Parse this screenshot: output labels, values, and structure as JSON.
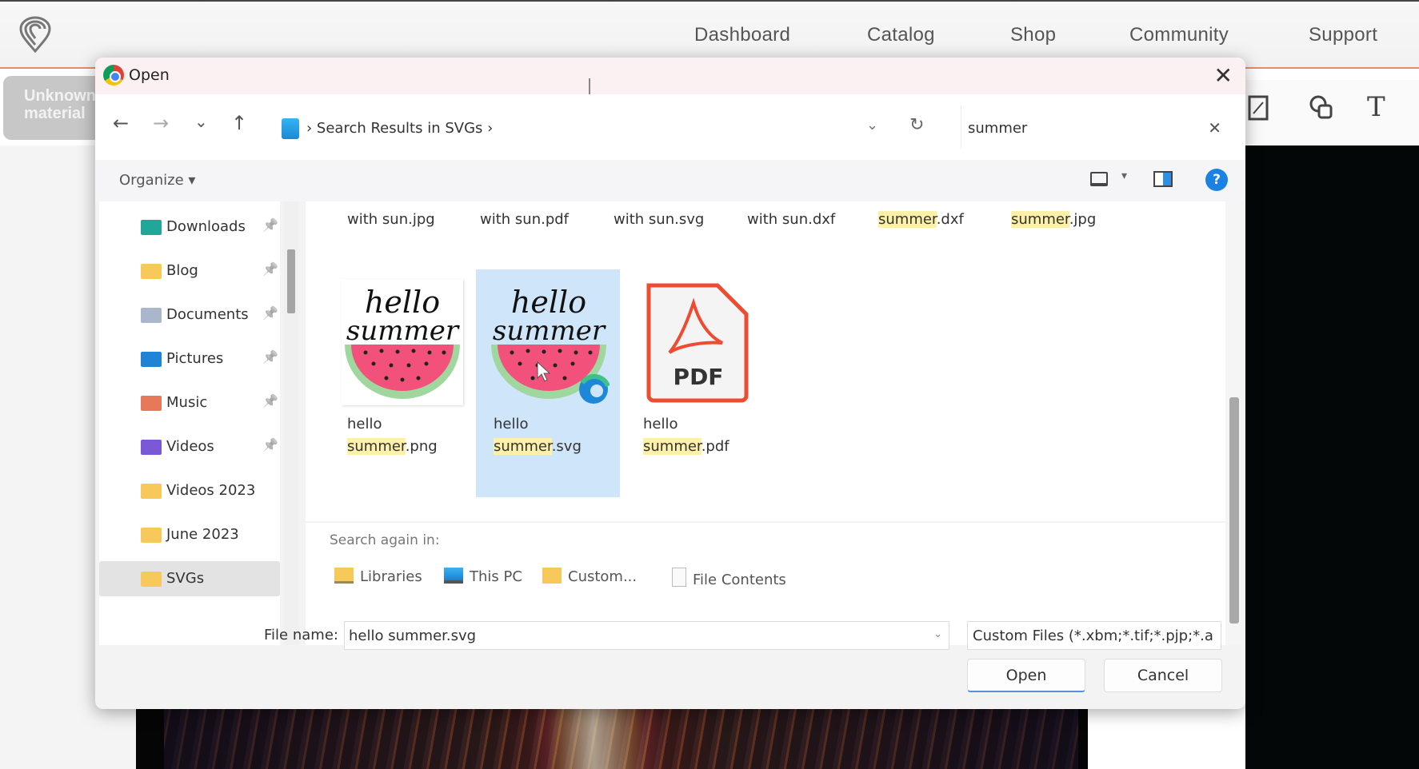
{
  "app": {
    "nav": [
      "Dashboard",
      "Catalog",
      "Shop",
      "Community",
      "Support"
    ],
    "left_button": "Unknown material",
    "tools": [
      "trace-image-icon",
      "shapes-icon",
      "text-icon"
    ],
    "text_tool_glyph": "T"
  },
  "dialog": {
    "title": "Open",
    "close_glyph": "✕",
    "nav_buttons": {
      "back": "←",
      "forward": "→",
      "recent": "⌄",
      "up": "↑"
    },
    "breadcrumb": "Search Results in SVGs",
    "refresh_glyph": "↻",
    "address_dropdown_glyph": "⌄",
    "search": {
      "value": "summer",
      "clear_glyph": "✕"
    },
    "toolbar": {
      "organize": "Organize ▾",
      "help": "?",
      "view_dot": "▾"
    },
    "navpane": [
      {
        "label": "Downloads",
        "pinned": true,
        "color": "#1fa89a"
      },
      {
        "label": "Blog",
        "pinned": true,
        "color": "#f6c95a"
      },
      {
        "label": "Documents",
        "pinned": true,
        "color": "#a9b6cc"
      },
      {
        "label": "Pictures",
        "pinned": true,
        "color": "#1f84d6"
      },
      {
        "label": "Music",
        "pinned": true,
        "color": "#e7785a"
      },
      {
        "label": "Videos",
        "pinned": true,
        "color": "#7b58d6"
      },
      {
        "label": "Videos 2023",
        "pinned": false,
        "color": "#f6c95a"
      },
      {
        "label": "June 2023",
        "pinned": false,
        "color": "#f6c95a"
      },
      {
        "label": "SVGs",
        "pinned": false,
        "color": "#f6c95a",
        "selected": true
      }
    ],
    "pin_glyph": "📌",
    "top_row": [
      {
        "pre": "with sun.jpg",
        "hl": "",
        "post": ""
      },
      {
        "pre": "with sun.pdf",
        "hl": "",
        "post": ""
      },
      {
        "pre": "with sun.svg",
        "hl": "",
        "post": ""
      },
      {
        "pre": "with sun.dxf",
        "hl": "",
        "post": ""
      },
      {
        "pre": "",
        "hl": "summer",
        "post": ".dxf"
      },
      {
        "pre": "",
        "hl": "summer",
        "post": ".jpg"
      }
    ],
    "files": [
      {
        "line1": "hello",
        "hl": "summer",
        "ext": ".png",
        "type": "image"
      },
      {
        "line1": "hello",
        "hl": "summer",
        "ext": ".svg",
        "type": "image",
        "selected": true
      },
      {
        "line1": "hello",
        "hl": "summer",
        "ext": ".pdf",
        "type": "pdf"
      }
    ],
    "thumb_text": [
      "hello",
      "summer"
    ],
    "pdf_label": "PDF",
    "search_again": {
      "label": "Search again in:",
      "items": [
        "Libraries",
        "This PC",
        "Custom...",
        "File Contents"
      ]
    },
    "file_name_label": "File name:",
    "file_name_value": "hello summer.svg",
    "file_type": "Custom Files (*.xbm;*.tif;*.pjp;*.a",
    "open_label": "Open",
    "cancel_label": "Cancel"
  }
}
